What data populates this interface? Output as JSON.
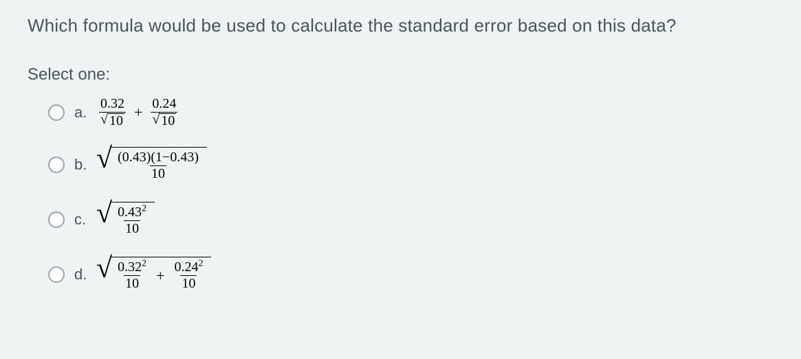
{
  "question": "Which formula would be used to calculate the standard error based on this data?",
  "prompt": "Select one:",
  "options": {
    "a": {
      "letter": "a.",
      "term1_num": "0.32",
      "term1_den": "10",
      "term2_num": "0.24",
      "term2_den": "10"
    },
    "b": {
      "letter": "b.",
      "num": "(0.43)(1−0.43)",
      "den": "10"
    },
    "c": {
      "letter": "c.",
      "base": "0.43",
      "exp": "2",
      "den": "10"
    },
    "d": {
      "letter": "d.",
      "t1_base": "0.32",
      "t1_exp": "2",
      "t1_den": "10",
      "t2_base": "0.24",
      "t2_exp": "2",
      "t2_den": "10"
    }
  }
}
